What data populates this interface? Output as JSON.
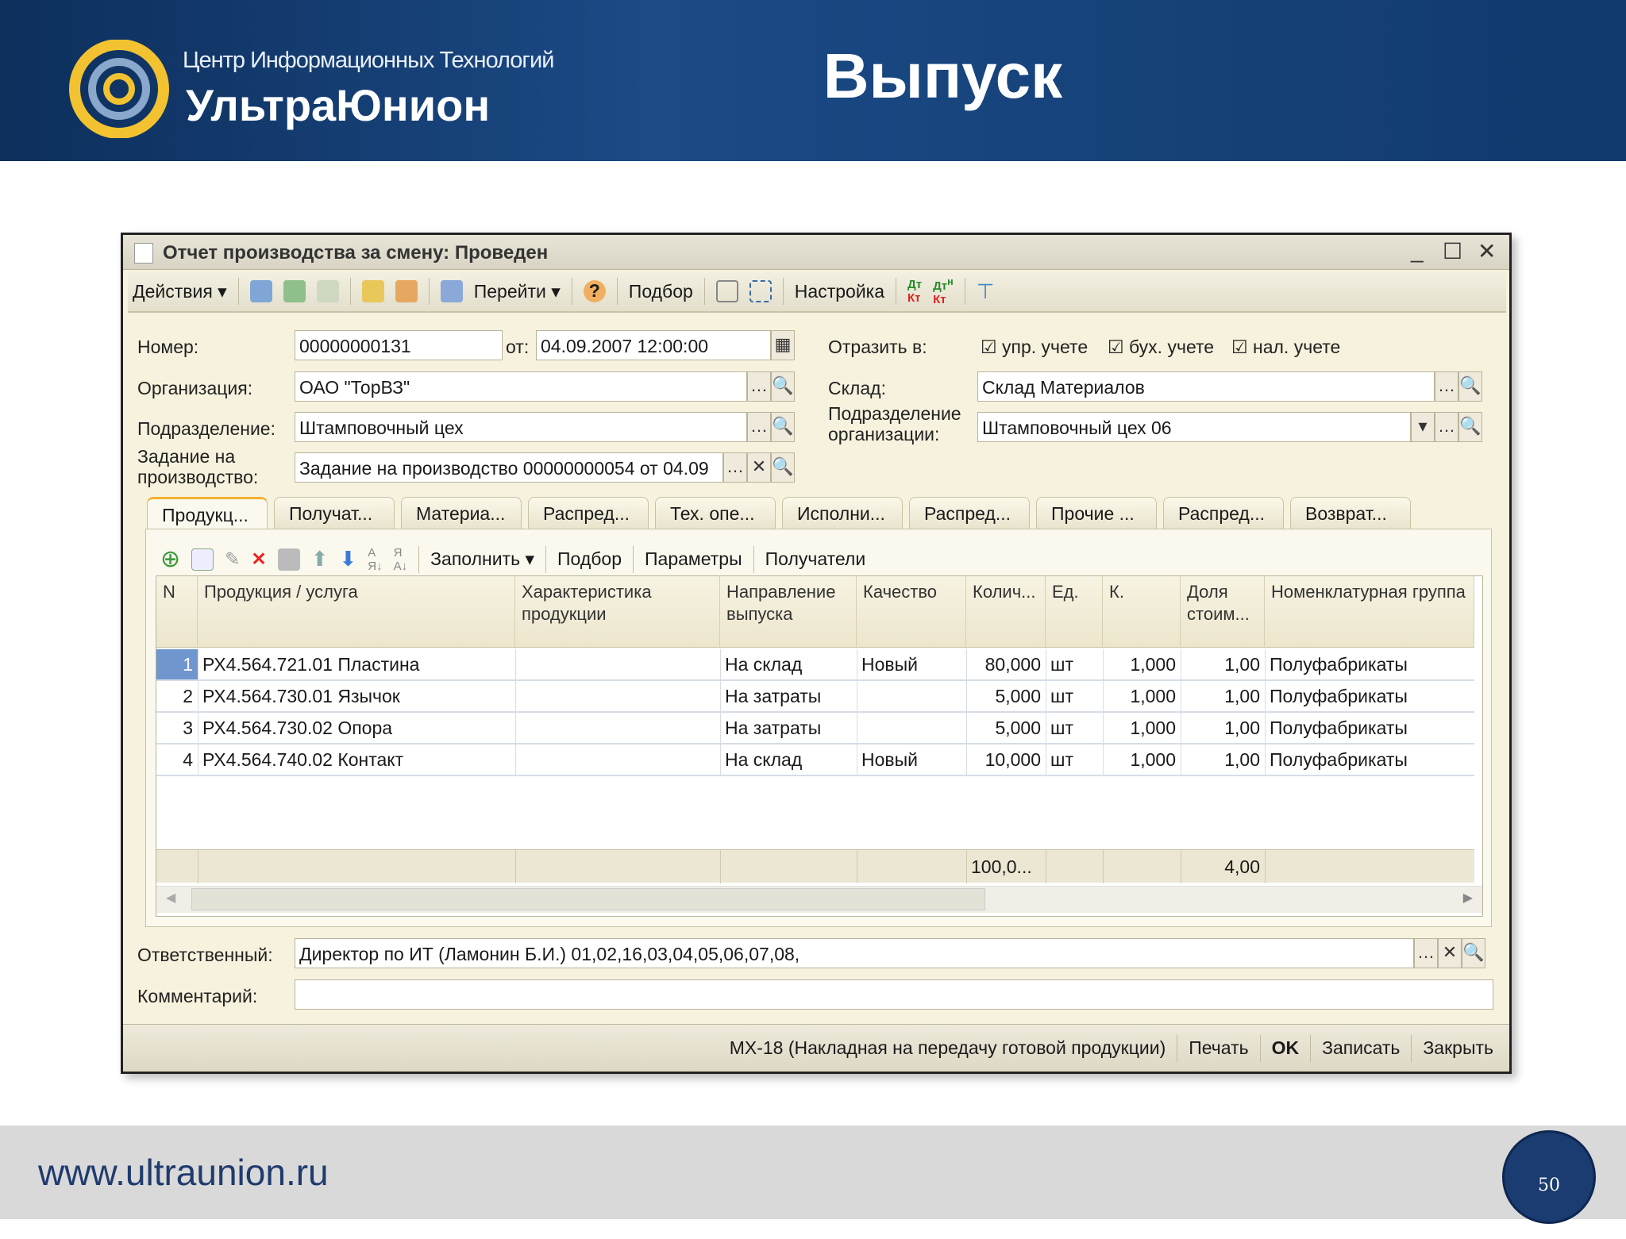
{
  "slide": {
    "brand_top": "Центр Информационных Технологий",
    "brand_name": "УльтраЮнион",
    "title": "Выпуск",
    "url": "www.ultraunion.ru",
    "page": "50"
  },
  "window": {
    "title": "Отчет производства за смену: Проведен"
  },
  "toolbar": {
    "actions": "Действия ▾",
    "goto": "Перейти ▾",
    "selection": "Подбор",
    "settings": "Настройка"
  },
  "form": {
    "number_label": "Номер:",
    "number": "00000000131",
    "date_label": "от:",
    "date": "04.09.2007 12:00:00",
    "reflect_label": "Отразить в:",
    "checks": [
      "упр. учете",
      "бух. учете",
      "нал. учете"
    ],
    "org_label": "Организация:",
    "org": "ОАО \"ТорВЗ\"",
    "warehouse_label": "Склад:",
    "warehouse": "Склад Материалов",
    "dept_label": "Подразделение:",
    "dept": "Штамповочный цех",
    "org_dept_label": "Подразделение организации:",
    "org_dept": "Штамповочный цех 06",
    "task_label": "Задание на производство:",
    "task": "Задание на производство 00000000054 от 04.09",
    "resp_label": "Ответственный:",
    "resp": "Директор по ИТ (Ламонин Б.И.)  01,02,16,03,04,05,06,07,08,",
    "comment_label": "Комментарий:",
    "comment": ""
  },
  "tabs": [
    "Продукц...",
    "Получат...",
    "Материа...",
    "Распред...",
    "Тех. опе...",
    "Исполни...",
    "Распред...",
    "Прочие ...",
    "Распред...",
    "Возврат..."
  ],
  "inner_toolbar": {
    "fill": "Заполнить ▾",
    "selection": "Подбор",
    "params": "Параметры",
    "recipients": "Получатели"
  },
  "table": {
    "headers": [
      "N",
      "Продукция / услуга",
      "Характеристика продукции",
      "Направление выпуска",
      "Качество",
      "Колич...",
      "Ед.",
      "К.",
      "Доля стоим...",
      "Номенклатурная группа"
    ],
    "rows": [
      [
        "1",
        "РХ4.564.721.01 Пластина",
        "",
        "На склад",
        "Новый",
        "80,000",
        "шт",
        "1,000",
        "1,00",
        "Полуфабрикаты"
      ],
      [
        "2",
        "РХ4.564.730.01 Язычок",
        "",
        "На затраты",
        "",
        "5,000",
        "шт",
        "1,000",
        "1,00",
        "Полуфабрикаты"
      ],
      [
        "3",
        "РХ4.564.730.02 Опора",
        "",
        "На затраты",
        "",
        "5,000",
        "шт",
        "1,000",
        "1,00",
        "Полуфабрикаты"
      ],
      [
        "4",
        "РХ4.564.740.02 Контакт",
        "",
        "На склад",
        "Новый",
        "10,000",
        "шт",
        "1,000",
        "1,00",
        "Полуфабрикаты"
      ]
    ],
    "totals": {
      "qty": "100,0...",
      "share": "4,00"
    }
  },
  "bottom": {
    "mx18": "МХ-18 (Накладная на передачу готовой продукции)",
    "print": "Печать",
    "ok": "OK",
    "save": "Записать",
    "close": "Закрыть"
  }
}
